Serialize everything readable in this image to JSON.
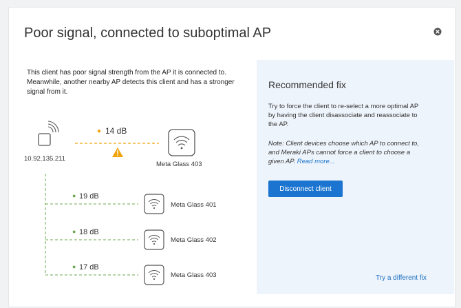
{
  "dialog": {
    "title": "Poor signal, connected to suboptimal AP",
    "description": "This client has poor signal strength from the AP it is connected to. Meanwhile, another nearby AP detects this client and has a stronger signal from it."
  },
  "diagram": {
    "client_ip": "10.92.135.211",
    "connected_signal": "14 dB",
    "connected_ap": "Meta Glass 403",
    "nearby": [
      {
        "signal": "19 dB",
        "ap": "Meta Glass 401"
      },
      {
        "signal": "18 dB",
        "ap": "Meta Glass 402"
      },
      {
        "signal": "17 dB",
        "ap": "Meta Glass 403"
      }
    ],
    "colors": {
      "warning": "#f0a30a",
      "good": "#6aa84f"
    },
    "icons": [
      "client-device-icon",
      "wifi-icon",
      "warning-icon",
      "close-icon"
    ]
  },
  "fix": {
    "title": "Recommended fix",
    "body": "Try to force the client to re-select a more optimal AP by having the client disassociate and reassociate to the AP.",
    "note": "Note: Client devices choose which AP to connect to, and Meraki APs cannot force a client to choose a given AP.",
    "read_more": "Read more...",
    "button": "Disconnect client",
    "alt_link": "Try a different fix",
    "accent": "#1a74d0"
  }
}
